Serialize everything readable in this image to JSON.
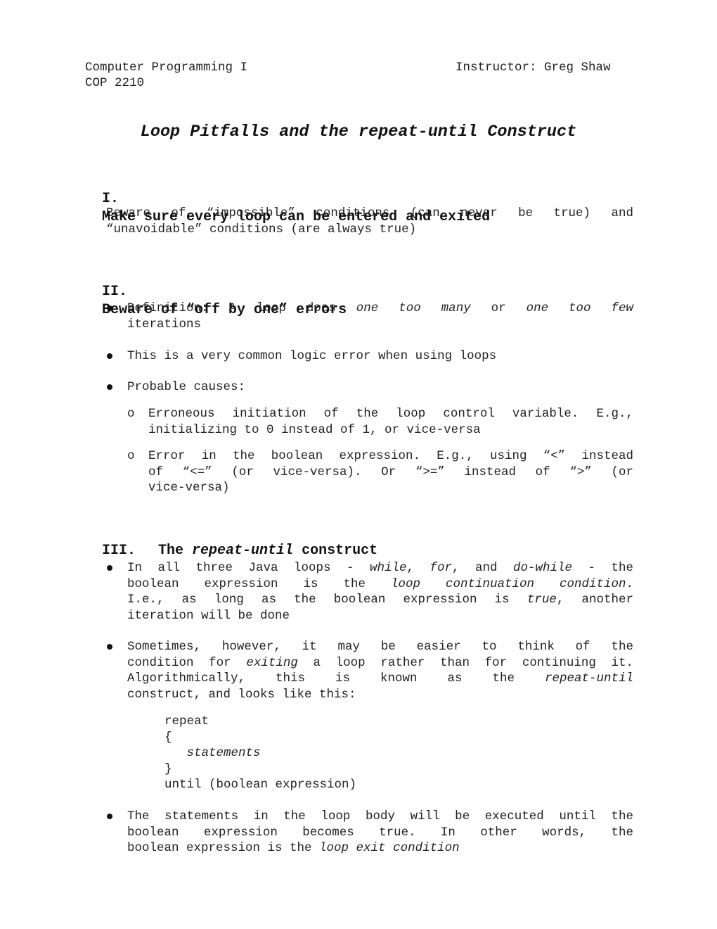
{
  "header": {
    "course": "Computer Programming I",
    "instructor": "Instructor: Greg Shaw",
    "code": "COP 2210"
  },
  "title": "Loop Pitfalls and the repeat-until Construct",
  "sections": [
    {
      "number": "I.",
      "heading": "Make sure every loop can be entered and exited",
      "body": [
        "Beware of “impossible” conditions (can never be true) and",
        "“unavoidable” conditions (are always true)"
      ]
    },
    {
      "number": "II.",
      "heading": "Beware of “off by one” errors",
      "bullets": [
        {
          "lines": [
            [
              "Definition: A loop does ",
              {
                "i": "one too many"
              },
              " or ",
              {
                "i": "one too few"
              }
            ],
            [
              "iterations"
            ]
          ]
        },
        {
          "lines": [
            [
              "This is a very common logic error when using loops"
            ]
          ]
        },
        {
          "lines": [
            [
              "Probable causes:"
            ]
          ],
          "sub_marker": "o",
          "sub": [
            [
              "Erroneous initiation of the loop control variable. E.g.,",
              "initializing to 0 instead of 1, or vice-versa"
            ],
            [
              "Error in the boolean expression. E.g., using “<” instead",
              "of “<=” (or vice-versa).  Or “>=” instead of “>” (or",
              "vice-versa)"
            ]
          ]
        }
      ]
    },
    {
      "number": "III.",
      "heading_pre": "The ",
      "heading_italic": "repeat-until",
      "heading_post": " construct",
      "bullets": [
        {
          "lines": [
            [
              "In all three Java loops - ",
              {
                "i": "while"
              },
              ", ",
              {
                "i": "for"
              },
              ", and ",
              {
                "i": "do-while"
              },
              " - the"
            ],
            [
              "boolean expression is the ",
              {
                "i": "loop continuation condition"
              },
              "."
            ],
            [
              "I.e., as long as the boolean expression is ",
              {
                "i": "true"
              },
              ", another"
            ],
            [
              "iteration will be done"
            ]
          ]
        },
        {
          "lines": [
            [
              "Sometimes, however, it may be easier to think of the"
            ],
            [
              "condition for ",
              {
                "i": "exiting"
              },
              " a loop rather than for continuing it."
            ],
            [
              "Algorithmically, this is known as the ",
              {
                "i": "repeat-until"
              }
            ],
            [
              "construct, and looks like this:"
            ]
          ],
          "code": [
            "repeat",
            "{",
            "   statements",
            "}",
            "until (boolean expression)"
          ]
        },
        {
          "lines": [
            [
              "The statements in the loop body will be executed until the"
            ],
            [
              "boolean expression becomes true.  In other words, the"
            ],
            [
              "boolean expression is the ",
              {
                "i": "loop exit condition"
              }
            ]
          ]
        }
      ]
    }
  ]
}
